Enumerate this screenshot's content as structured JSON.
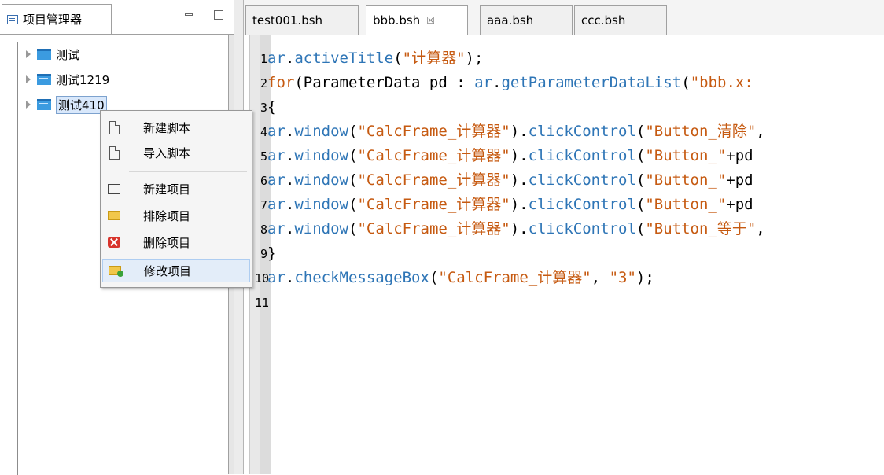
{
  "left_panel": {
    "title": "项目管理器",
    "tree": [
      {
        "label": "测试"
      },
      {
        "label": "测试1219"
      },
      {
        "label": "测试410",
        "selected": true
      }
    ]
  },
  "context_menu": {
    "items": [
      {
        "label": "新建脚本",
        "icon": "new-script-icon"
      },
      {
        "label": "导入脚本",
        "icon": "import-script-icon"
      },
      {
        "label": "新建项目",
        "icon": "new-project-icon"
      },
      {
        "label": "排除项目",
        "icon": "exclude-project-icon"
      },
      {
        "label": "删除项目",
        "icon": "delete-project-icon"
      },
      {
        "label": "修改项目",
        "icon": "edit-project-icon",
        "highlighted": true
      }
    ]
  },
  "editor": {
    "tabs": [
      {
        "label": "test001.bsh"
      },
      {
        "label": "bbb.bsh",
        "active": true,
        "close": "☒"
      },
      {
        "label": "aaa.bsh"
      },
      {
        "label": "ccc.bsh"
      }
    ],
    "lines": [
      {
        "n": "1",
        "parts": [
          [
            "ident",
            "ar"
          ],
          [
            "plain",
            "."
          ],
          [
            "ident",
            "activeTitle"
          ],
          [
            "plain",
            "("
          ],
          [
            "str",
            "\"计算器\""
          ],
          [
            "plain",
            ");"
          ]
        ]
      },
      {
        "n": "2",
        "parts": [
          [
            "kw",
            "for"
          ],
          [
            "plain",
            "(ParameterData pd : "
          ],
          [
            "ident",
            "ar"
          ],
          [
            "plain",
            "."
          ],
          [
            "ident",
            "getParameterDataList"
          ],
          [
            "plain",
            "("
          ],
          [
            "str",
            "\"bbb.x:"
          ]
        ]
      },
      {
        "n": "3",
        "parts": [
          [
            "plain",
            "{"
          ]
        ]
      },
      {
        "n": "4",
        "parts": [
          [
            "ident",
            "ar"
          ],
          [
            "plain",
            "."
          ],
          [
            "ident",
            "window"
          ],
          [
            "plain",
            "("
          ],
          [
            "str",
            "\"CalcFrame_计算器\""
          ],
          [
            "plain",
            ")."
          ],
          [
            "ident",
            "clickControl"
          ],
          [
            "plain",
            "("
          ],
          [
            "str",
            "\"Button_清除\""
          ],
          [
            "plain",
            ","
          ]
        ]
      },
      {
        "n": "5",
        "parts": [
          [
            "ident",
            "ar"
          ],
          [
            "plain",
            "."
          ],
          [
            "ident",
            "window"
          ],
          [
            "plain",
            "("
          ],
          [
            "str",
            "\"CalcFrame_计算器\""
          ],
          [
            "plain",
            ")."
          ],
          [
            "ident",
            "clickControl"
          ],
          [
            "plain",
            "("
          ],
          [
            "str",
            "\"Button_\""
          ],
          [
            "plain",
            "+pd"
          ]
        ]
      },
      {
        "n": "6",
        "parts": [
          [
            "ident",
            "ar"
          ],
          [
            "plain",
            "."
          ],
          [
            "ident",
            "window"
          ],
          [
            "plain",
            "("
          ],
          [
            "str",
            "\"CalcFrame_计算器\""
          ],
          [
            "plain",
            ")."
          ],
          [
            "ident",
            "clickControl"
          ],
          [
            "plain",
            "("
          ],
          [
            "str",
            "\"Button_\""
          ],
          [
            "plain",
            "+pd"
          ]
        ]
      },
      {
        "n": "7",
        "parts": [
          [
            "ident",
            "ar"
          ],
          [
            "plain",
            "."
          ],
          [
            "ident",
            "window"
          ],
          [
            "plain",
            "("
          ],
          [
            "str",
            "\"CalcFrame_计算器\""
          ],
          [
            "plain",
            ")."
          ],
          [
            "ident",
            "clickControl"
          ],
          [
            "plain",
            "("
          ],
          [
            "str",
            "\"Button_\""
          ],
          [
            "plain",
            "+pd"
          ]
        ]
      },
      {
        "n": "8",
        "parts": [
          [
            "ident",
            "ar"
          ],
          [
            "plain",
            "."
          ],
          [
            "ident",
            "window"
          ],
          [
            "plain",
            "("
          ],
          [
            "str",
            "\"CalcFrame_计算器\""
          ],
          [
            "plain",
            ")."
          ],
          [
            "ident",
            "clickControl"
          ],
          [
            "plain",
            "("
          ],
          [
            "str",
            "\"Button_等于\""
          ],
          [
            "plain",
            ","
          ]
        ]
      },
      {
        "n": "9",
        "parts": [
          [
            "plain",
            "}"
          ]
        ]
      },
      {
        "n": "10",
        "parts": [
          [
            "ident",
            "ar"
          ],
          [
            "plain",
            "."
          ],
          [
            "ident",
            "checkMessageBox"
          ],
          [
            "plain",
            "("
          ],
          [
            "str",
            "\"CalcFrame_计算器\""
          ],
          [
            "plain",
            ", "
          ],
          [
            "str",
            "\"3\""
          ],
          [
            "plain",
            ");"
          ]
        ]
      },
      {
        "n": "11",
        "parts": []
      }
    ]
  },
  "colors": {
    "identifier": "#2e75b6",
    "string": "#c65a11",
    "keyword": "#c65a11",
    "selection": "#d9e8fb",
    "menu_highlight": "#e3edf9"
  }
}
